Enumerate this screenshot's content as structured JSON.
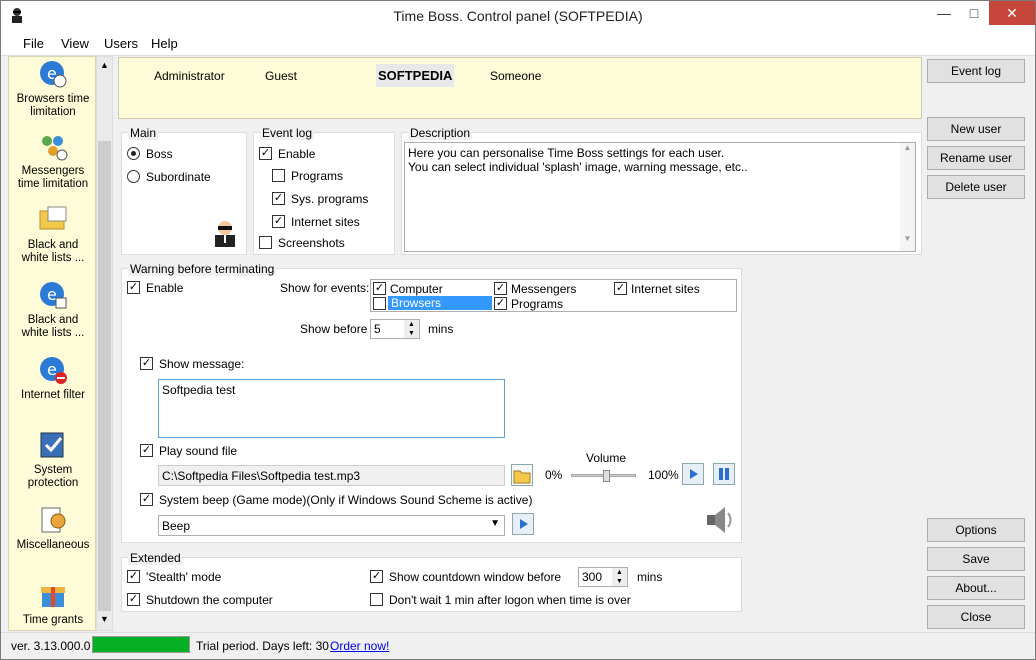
{
  "window": {
    "title": "Time Boss. Control panel (SOFTPEDIA)"
  },
  "menu": {
    "file": "File",
    "view": "View",
    "users": "Users",
    "help": "Help"
  },
  "sidebar": {
    "items": [
      {
        "label_1": "Browsers time",
        "label_2": "limitation"
      },
      {
        "label_1": "Messengers",
        "label_2": "time limitation"
      },
      {
        "label_1": "Black and",
        "label_2": "white lists ..."
      },
      {
        "label_1": "Black and",
        "label_2": "white lists ..."
      },
      {
        "label_1": "Internet filter",
        "label_2": ""
      },
      {
        "label_1": "System",
        "label_2": "protection"
      },
      {
        "label_1": "Miscellaneous",
        "label_2": ""
      },
      {
        "label_1": "Time grants",
        "label_2": ""
      }
    ]
  },
  "users": {
    "administrator": "Administrator",
    "guest": "Guest",
    "softpedia": "SOFTPEDIA",
    "someone": "Someone"
  },
  "main_group": {
    "title": "Main",
    "boss": "Boss",
    "subordinate": "Subordinate"
  },
  "event_log_group": {
    "title": "Event log",
    "enable": "Enable",
    "programs": "Programs",
    "sys_programs": "Sys. programs",
    "internet_sites": "Internet sites",
    "screenshots": "Screenshots"
  },
  "description": {
    "title": "Description",
    "line_1": "Here you can personalise Time Boss settings for each user.",
    "line_2": "You can select individual 'splash' image, warning message, etc.."
  },
  "warning": {
    "title": "Warning before terminating",
    "enable": "Enable",
    "show_for_events": "Show for events:",
    "events": {
      "computer": "Computer",
      "messengers": "Messengers",
      "internet_sites": "Internet sites",
      "browsers": "Browsers",
      "programs": "Programs"
    },
    "show_before": "Show before",
    "show_before_value": "5",
    "mins": "mins",
    "show_message": "Show message:",
    "message_text": "Softpedia test",
    "play_sound": "Play sound file",
    "sound_path": "C:\\Softpedia Files\\Softpedia test.mp3",
    "volume": "Volume",
    "vol_min": "0%",
    "vol_max": "100%",
    "volume_level": 0.55,
    "system_beep": "System beep (Game mode)(Only if Windows Sound Scheme is active)",
    "beep_value": "Beep"
  },
  "extended": {
    "title": "Extended",
    "stealth": "'Stealth' mode",
    "shutdown": "Shutdown the computer",
    "countdown": "Show countdown window before",
    "countdown_value": "300",
    "mins": "mins",
    "dont_wait": "Don't wait 1 min after logon when time is over"
  },
  "buttons": {
    "event_log": "Event log",
    "new_user": "New user",
    "rename_user": "Rename user",
    "delete_user": "Delete user",
    "options": "Options",
    "save": "Save",
    "about": "About...",
    "close": "Close"
  },
  "status": {
    "version": "ver. 3.13.000.0",
    "trial": "Trial period. Days left: 30",
    "order": "Order now!"
  }
}
